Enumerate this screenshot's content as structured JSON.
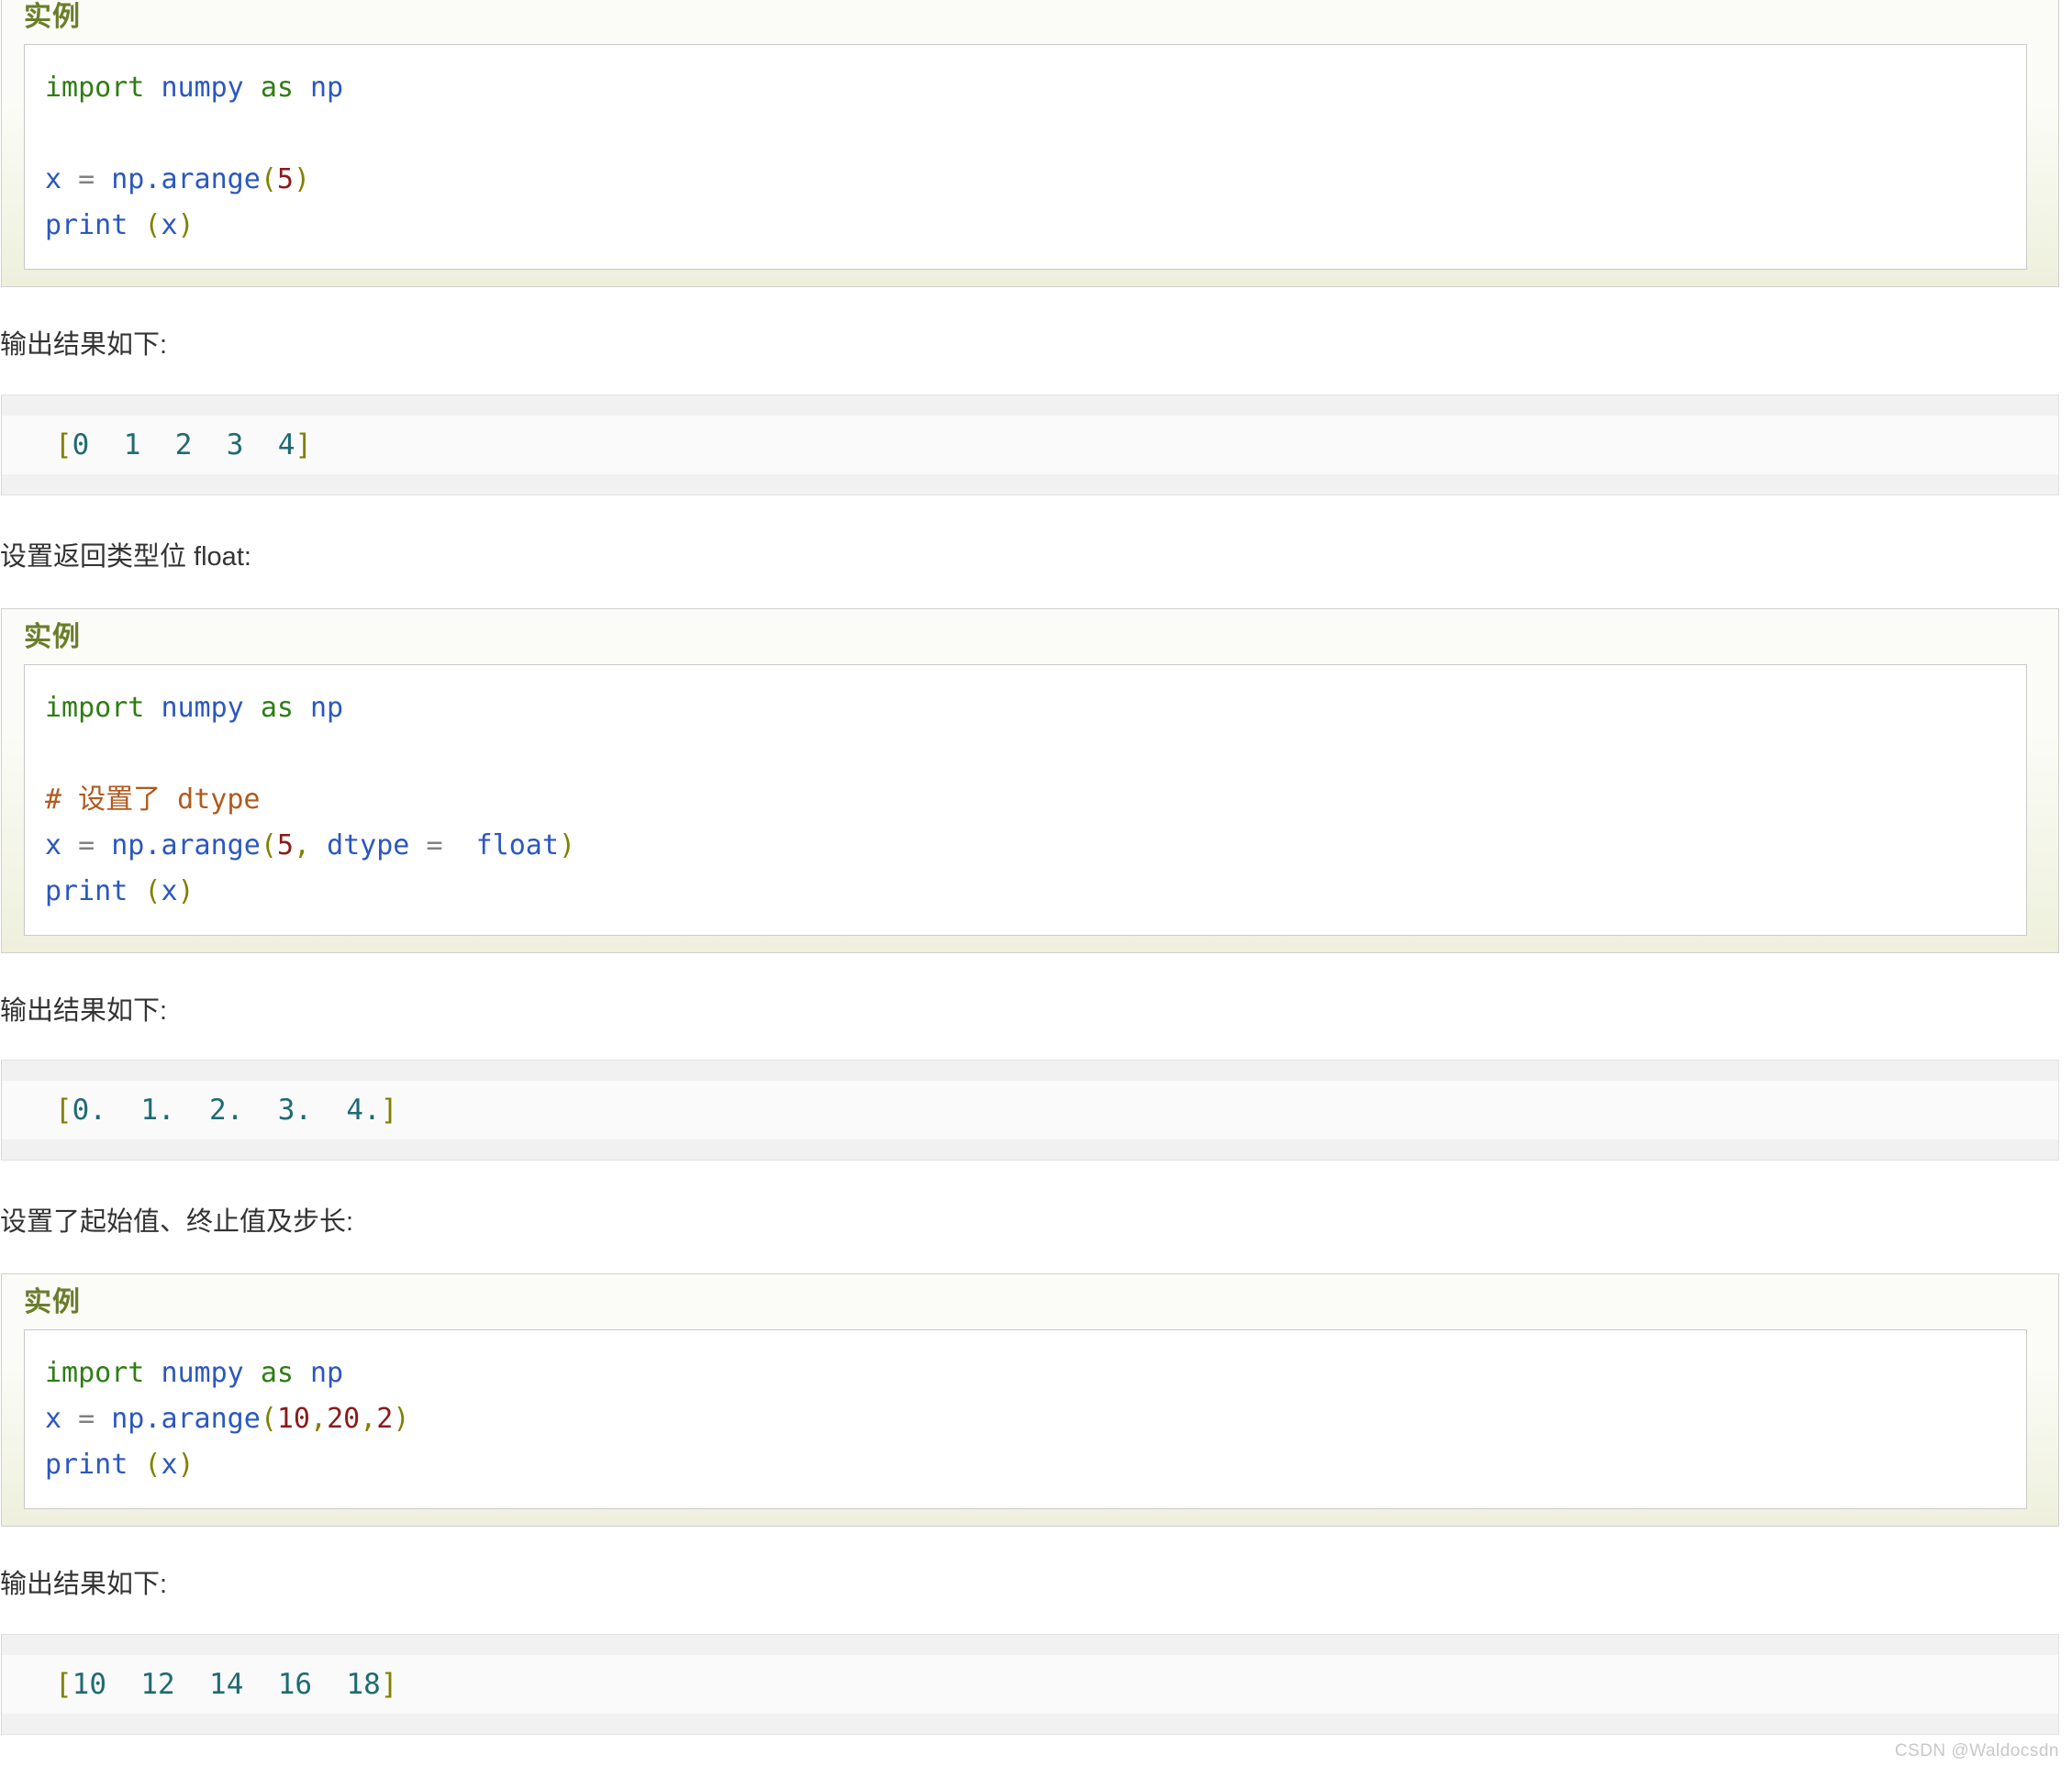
{
  "page": {
    "watermark": "CSDN @Waldocsdn"
  },
  "labels": {
    "example_title": "实例",
    "output_intro": "输出结果如下:"
  },
  "sections": [
    {
      "id": "basic-arange",
      "intro": null,
      "example_title": "实例",
      "code_lines": [
        {
          "tokens": [
            {
              "t": "import",
              "c": "kw"
            },
            {
              "t": " ",
              "c": "plain"
            },
            {
              "t": "numpy",
              "c": "name"
            },
            {
              "t": " ",
              "c": "plain"
            },
            {
              "t": "as",
              "c": "kw"
            },
            {
              "t": " ",
              "c": "plain"
            },
            {
              "t": "np",
              "c": "name"
            }
          ]
        },
        {
          "tokens": []
        },
        {
          "tokens": [
            {
              "t": "x",
              "c": "name"
            },
            {
              "t": " ",
              "c": "plain"
            },
            {
              "t": "=",
              "c": "op"
            },
            {
              "t": " ",
              "c": "plain"
            },
            {
              "t": "np",
              "c": "name"
            },
            {
              "t": ".",
              "c": "dot"
            },
            {
              "t": "arange",
              "c": "name"
            },
            {
              "t": "(",
              "c": "punc"
            },
            {
              "t": "5",
              "c": "num"
            },
            {
              "t": ")",
              "c": "punc"
            }
          ]
        },
        {
          "tokens": [
            {
              "t": "print",
              "c": "name"
            },
            {
              "t": " ",
              "c": "plain"
            },
            {
              "t": "(",
              "c": "punc"
            },
            {
              "t": "x",
              "c": "name"
            },
            {
              "t": ")",
              "c": "punc"
            }
          ]
        }
      ],
      "output_intro": "输出结果如下:",
      "output_text": "[0  1  2  3  4]"
    },
    {
      "id": "arange-dtype-float",
      "intro": "设置返回类型位 float:",
      "example_title": "实例",
      "code_lines": [
        {
          "tokens": [
            {
              "t": "import",
              "c": "kw"
            },
            {
              "t": " ",
              "c": "plain"
            },
            {
              "t": "numpy",
              "c": "name"
            },
            {
              "t": " ",
              "c": "plain"
            },
            {
              "t": "as",
              "c": "kw"
            },
            {
              "t": " ",
              "c": "plain"
            },
            {
              "t": "np",
              "c": "name"
            }
          ]
        },
        {
          "tokens": []
        },
        {
          "tokens": [
            {
              "t": "# 设置了 dtype",
              "c": "comment"
            }
          ]
        },
        {
          "tokens": [
            {
              "t": "x",
              "c": "name"
            },
            {
              "t": " ",
              "c": "plain"
            },
            {
              "t": "=",
              "c": "op"
            },
            {
              "t": " ",
              "c": "plain"
            },
            {
              "t": "np",
              "c": "name"
            },
            {
              "t": ".",
              "c": "dot"
            },
            {
              "t": "arange",
              "c": "name"
            },
            {
              "t": "(",
              "c": "punc"
            },
            {
              "t": "5",
              "c": "num"
            },
            {
              "t": ",",
              "c": "punc"
            },
            {
              "t": " ",
              "c": "plain"
            },
            {
              "t": "dtype",
              "c": "name"
            },
            {
              "t": " ",
              "c": "plain"
            },
            {
              "t": "=",
              "c": "op"
            },
            {
              "t": "  ",
              "c": "plain"
            },
            {
              "t": "float",
              "c": "name"
            },
            {
              "t": ")",
              "c": "punc"
            }
          ]
        },
        {
          "tokens": [
            {
              "t": "print",
              "c": "name"
            },
            {
              "t": " ",
              "c": "plain"
            },
            {
              "t": "(",
              "c": "punc"
            },
            {
              "t": "x",
              "c": "name"
            },
            {
              "t": ")",
              "c": "punc"
            }
          ]
        }
      ],
      "output_intro": "输出结果如下:",
      "output_text": "[0.  1.  2.  3.  4.]"
    },
    {
      "id": "arange-start-stop-step",
      "intro": "设置了起始值、终止值及步长:",
      "example_title": "实例",
      "code_lines": [
        {
          "tokens": [
            {
              "t": "import",
              "c": "kw"
            },
            {
              "t": " ",
              "c": "plain"
            },
            {
              "t": "numpy",
              "c": "name"
            },
            {
              "t": " ",
              "c": "plain"
            },
            {
              "t": "as",
              "c": "kw"
            },
            {
              "t": " ",
              "c": "plain"
            },
            {
              "t": "np",
              "c": "name"
            }
          ]
        },
        {
          "tokens": [
            {
              "t": "x",
              "c": "name"
            },
            {
              "t": " ",
              "c": "plain"
            },
            {
              "t": "=",
              "c": "op"
            },
            {
              "t": " ",
              "c": "plain"
            },
            {
              "t": "np",
              "c": "name"
            },
            {
              "t": ".",
              "c": "dot"
            },
            {
              "t": "arange",
              "c": "name"
            },
            {
              "t": "(",
              "c": "punc"
            },
            {
              "t": "10",
              "c": "num"
            },
            {
              "t": ",",
              "c": "punc"
            },
            {
              "t": "20",
              "c": "num"
            },
            {
              "t": ",",
              "c": "punc"
            },
            {
              "t": "2",
              "c": "num"
            },
            {
              "t": ")",
              "c": "punc"
            }
          ]
        },
        {
          "tokens": [
            {
              "t": "print",
              "c": "name"
            },
            {
              "t": " ",
              "c": "plain"
            },
            {
              "t": "(",
              "c": "punc"
            },
            {
              "t": "x",
              "c": "name"
            },
            {
              "t": ")",
              "c": "punc"
            }
          ]
        }
      ],
      "output_intro": "输出结果如下:",
      "output_text": "[10  12  14  16  18]"
    }
  ],
  "colors": {
    "keyword": "#2e7d14",
    "identifier": "#2b57bf",
    "number": "#8b1a1a",
    "punctuation": "#808000",
    "comment": "#b05a1e",
    "output_text": "#1f6a72",
    "example_title": "#6a7d2b",
    "example_bg": "#eef0dc"
  }
}
